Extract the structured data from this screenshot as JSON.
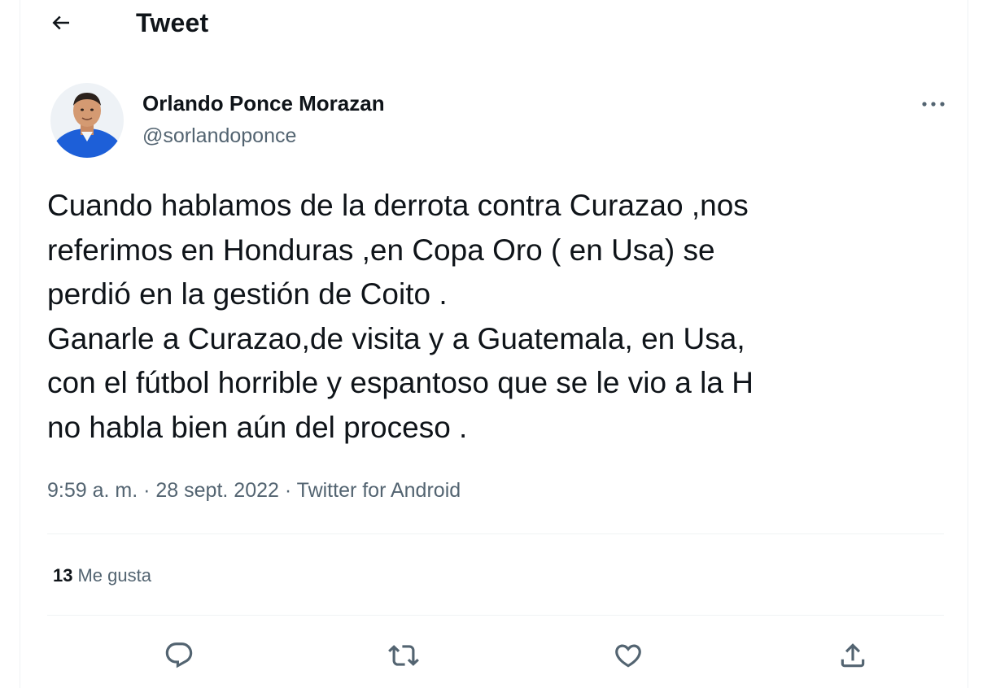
{
  "header": {
    "title": "Tweet",
    "back_icon": "arrow-left-icon"
  },
  "author": {
    "name": "Orlando Ponce Morazan",
    "handle": "@sorlandoponce"
  },
  "tweet": {
    "text": "Cuando hablamos de la derrota contra  Curazao ,nos\nreferimos en Honduras ,en Copa Oro ( en Usa)  se\nperdió en la gestión de Coito .\nGanarle a Curazao,de visita  y a Guatemala, en Usa,\ncon el fútbol horrible y espantoso  que se le vio a la H\nno habla bien aún del proceso .",
    "time": "9:59 a. m.",
    "separator": " · ",
    "date": "28 sept. 2022",
    "source": "Twitter for Android"
  },
  "stats": {
    "likes_count": "13",
    "likes_label": "Me gusta"
  },
  "actions": [
    {
      "name": "reply",
      "icon": "comment-icon"
    },
    {
      "name": "retweet",
      "icon": "retweet-icon"
    },
    {
      "name": "like",
      "icon": "heart-icon"
    },
    {
      "name": "share",
      "icon": "share-icon"
    }
  ],
  "colors": {
    "text": "#0f1419",
    "secondary": "#536471",
    "divider": "#eff3f4",
    "avatar_shirt": "#1d5fd8"
  }
}
